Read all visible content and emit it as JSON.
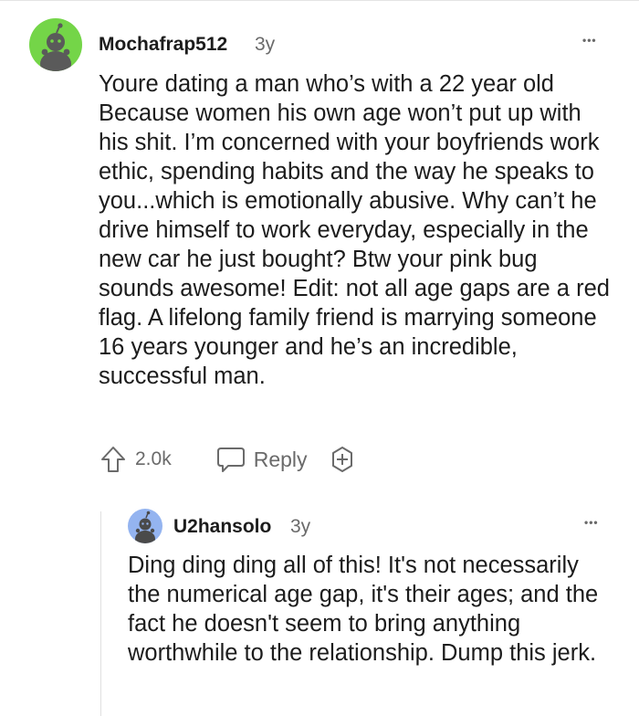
{
  "comments": [
    {
      "author": "Mochafrap512",
      "age": "3y",
      "avatar_color": "#74d548",
      "text": "Youre dating a man who’s with a 22 year old Because women his own age won’t put up with his shit. I’m concerned with your boyfriends work ethic, spending habits and the way he speaks to you...which is emotionally abusive. Why can’t he drive himself to work everyday, especially in the new car he just bought? Btw your pink bug sounds awesome! Edit: not all age gaps are a red flag. A lifelong family friend is marrying someone 16 years younger and he’s an incredible, successful man.",
      "votes": "2.0k",
      "reply_label": "Reply",
      "more_label": "•••"
    },
    {
      "author": "U2hansolo",
      "age": "3y",
      "avatar_color": "#94b4f0",
      "text": "Ding ding ding all of this! It's not necessarily the numerical age gap, it's their ages; and the fact he doesn't seem to bring anything worthwhile to the relationship. Dump this jerk.",
      "more_label": "•••"
    }
  ],
  "icons": {
    "upvote": "upvote-icon",
    "reply": "speech-bubble-icon",
    "award": "plus-award-icon",
    "more": "more-options-icon"
  }
}
